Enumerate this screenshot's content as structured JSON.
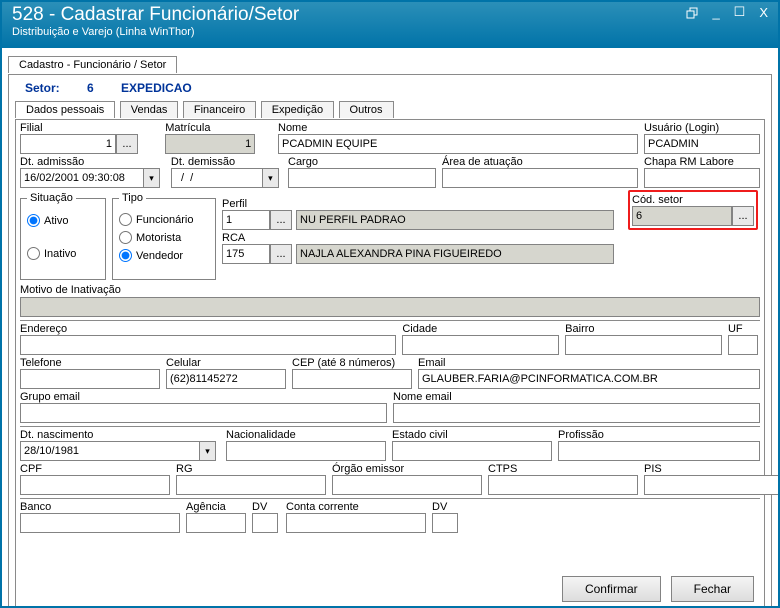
{
  "titlebar": {
    "title": "528 - Cadastrar Funcionário/Setor",
    "subtitle": "Distribuição e Varejo (Linha WinThor)"
  },
  "tab_outer": "Cadastro - Funcionário / Setor",
  "setor": {
    "label": "Setor:",
    "num": "6",
    "name": "EXPEDICAO"
  },
  "tabs": {
    "t1": "Dados pessoais",
    "t2": "Vendas",
    "t3": "Financeiro",
    "t4": "Expedição",
    "t5": "Outros"
  },
  "lbl": {
    "filial": "Filial",
    "matricula": "Matrícula",
    "nome": "Nome",
    "usuario": "Usuário (Login)",
    "dtadm": "Dt. admissão",
    "dtdem": "Dt.  demissão",
    "cargo": "Cargo",
    "area": "Área de atuação",
    "chapa": "Chapa RM Labore",
    "situacao": "Situação",
    "ativo": "Ativo",
    "inativo": "Inativo",
    "tipo": "Tipo",
    "funcionario": "Funcionário",
    "motorista": "Motorista",
    "vendedor": "Vendedor",
    "perfil": "Perfil",
    "rca": "RCA",
    "codsetor": "Cód. setor",
    "motivo": "Motivo de Inativação",
    "endereco": "Endereço",
    "cidade": "Cidade",
    "bairro": "Bairro",
    "uf": "UF",
    "telefone": "Telefone",
    "celular": "Celular",
    "cep": "CEP (até 8 números)",
    "email": "Email",
    "grupoemail": "Grupo email",
    "nomeemail": "Nome email",
    "dtnasc": "Dt. nascimento",
    "nacionalidade": "Nacionalidade",
    "estadocivil": "Estado civil",
    "profissao": "Profissão",
    "cpf": "CPF",
    "rg": "RG",
    "orgao": "Órgão emissor",
    "ctps": "CTPS",
    "pis": "PIS",
    "banco": "Banco",
    "agencia": "Agência",
    "dv": "DV",
    "conta": "Conta corrente",
    "dv2": "DV",
    "confirmar": "Confirmar",
    "fechar": "Fechar"
  },
  "val": {
    "filial": "1",
    "matricula": "1",
    "nome": "PCADMIN EQUIPE",
    "usuario": "PCADMIN",
    "dtadm": "16/02/2001 09:30:08",
    "dtdem": "  /  /",
    "perfil": "1",
    "perfildesc": "NU  PERFIL PADRAO",
    "rca": "175",
    "rcadesc": "NAJLA ALEXANDRA PINA FIGUEIREDO",
    "codsetor": "6",
    "celular": "(62)81145272",
    "email": "GLAUBER.FARIA@PCINFORMATICA.COM.BR",
    "dtnasc": "28/10/1981"
  },
  "icons": {
    "ellipsis": "...",
    "chevron": "▾",
    "restore": "❐",
    "min": "_",
    "max": "☐",
    "close": "X"
  }
}
